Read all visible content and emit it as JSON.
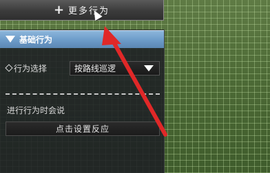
{
  "toolbar": {
    "more_behaviors_label": "更多行为",
    "plus_icon": "+"
  },
  "section": {
    "title": "基础行为",
    "icon": "triangle-down-icon"
  },
  "behavior": {
    "label": "行为选择",
    "selected": "按路线巡逻",
    "dropdown_icon": "triangle-down-icon"
  },
  "speak": {
    "label": "进行行为时会说",
    "button": "点击设置反应"
  },
  "colors": {
    "annotation_arrow": "#e02828",
    "header_blue": "#6f9ecb"
  }
}
